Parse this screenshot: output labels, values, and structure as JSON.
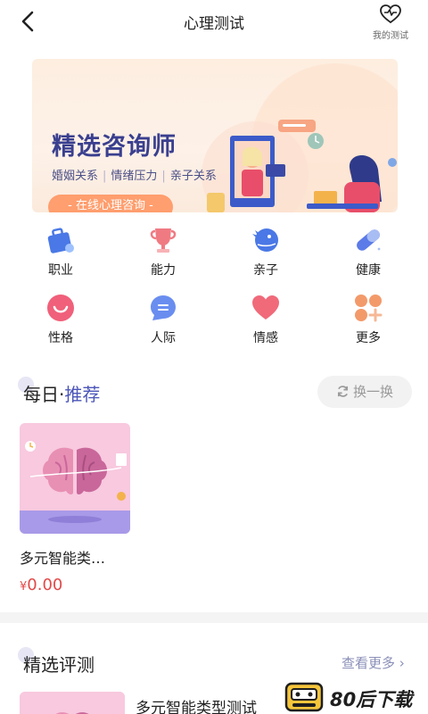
{
  "header": {
    "title": "心理测试",
    "my_test_label": "我的测试"
  },
  "banner": {
    "title": "精选咨询师",
    "tags": [
      "婚姻关系",
      "情绪压力",
      "亲子关系"
    ],
    "cta": "- 在线心理咨询 -"
  },
  "categories": [
    {
      "label": "职业",
      "icon": "briefcase-icon",
      "color": "#4a78e6"
    },
    {
      "label": "能力",
      "icon": "trophy-icon",
      "color": "#f07a82"
    },
    {
      "label": "亲子",
      "icon": "dinosaur-icon",
      "color": "#4a78e6"
    },
    {
      "label": "健康",
      "icon": "pill-icon",
      "color": "#5b7be8"
    },
    {
      "label": "性格",
      "icon": "smile-icon",
      "color": "#f0607a"
    },
    {
      "label": "人际",
      "icon": "chat-icon",
      "color": "#6a8ef0"
    },
    {
      "label": "情感",
      "icon": "heart-icon",
      "color": "#f06a7a"
    },
    {
      "label": "更多",
      "icon": "grid-dots-icon",
      "color": "#f39a6a"
    }
  ],
  "daily": {
    "title_main": "每日·",
    "title_accent": "推荐",
    "swap_label": "换一换",
    "item": {
      "title": "多元智能类…",
      "currency": "¥",
      "price": "0.00"
    }
  },
  "featured": {
    "title": "精选评测",
    "more_label": "查看更多",
    "item_title": "多元智能类型测试"
  },
  "watermark": {
    "text": "80后下载"
  },
  "colors": {
    "accent": "#4b55b8",
    "price": "#e24a4a",
    "muted": "#9a9a9a"
  }
}
